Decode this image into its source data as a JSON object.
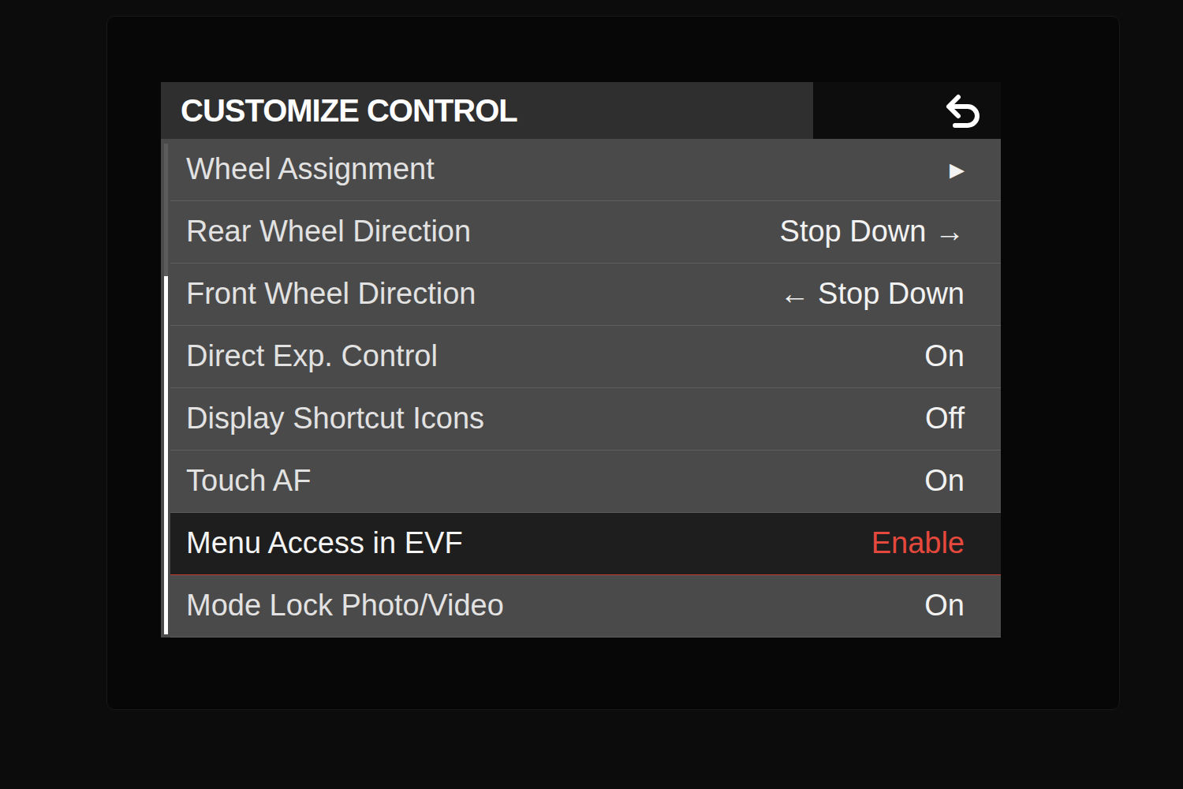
{
  "screen": {
    "title": "CUSTOMIZE CONTROL",
    "scrollbar": {
      "level": 0.73
    }
  },
  "rows": [
    {
      "label": "Wheel Assignment",
      "value": "▸",
      "selected": false
    },
    {
      "label": "Rear Wheel Direction",
      "value": "Stop Down →",
      "selected": false
    },
    {
      "label": "Front Wheel Direction",
      "value": "← Stop Down",
      "selected": false
    },
    {
      "label": "Direct Exp. Control",
      "value": "On",
      "selected": false
    },
    {
      "label": "Display Shortcut Icons",
      "value": "Off",
      "selected": false
    },
    {
      "label": "Touch AF",
      "value": "On",
      "selected": false
    },
    {
      "label": "Menu Access in EVF",
      "value": "Enable",
      "selected": true
    },
    {
      "label": "Mode Lock Photo/Video",
      "value": "On",
      "selected": false
    }
  ]
}
